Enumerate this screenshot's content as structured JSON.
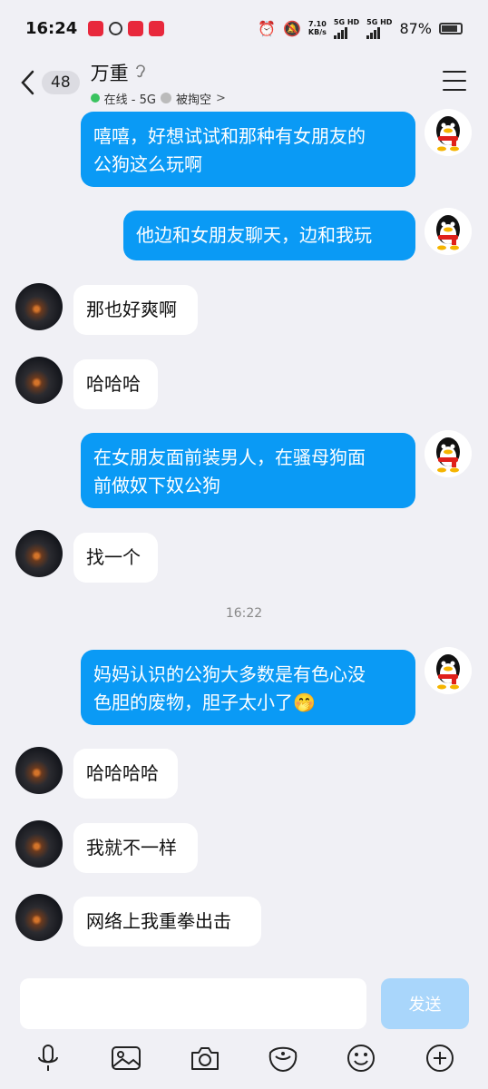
{
  "status_bar": {
    "time": "16:24",
    "net_speed_value": "7.10",
    "net_speed_unit": "KB/s",
    "sim1_label": "5G HD",
    "sim2_label": "5G HD",
    "battery": "87%"
  },
  "header": {
    "unread_count": "48",
    "contact_name": "万重",
    "status_text": "在线 - 5G",
    "poke_text": "被掏空",
    "online_color": "#3ac35f"
  },
  "messages": [
    {
      "side": "out",
      "text_line1": "嘻嘻，好想试试和那种有女朋友的",
      "text_line2": "公狗这么玩啊"
    },
    {
      "side": "out",
      "text_line1": "他边和女朋友聊天，边和我玩"
    },
    {
      "side": "in",
      "text_line1": "那也好爽啊"
    },
    {
      "side": "in",
      "text_line1": "哈哈哈"
    },
    {
      "side": "out",
      "text_line1": "在女朋友面前装男人，在骚母狗面",
      "text_line2": "前做奴下奴公狗"
    },
    {
      "side": "in",
      "text_line1": "找一个"
    },
    {
      "side": "out",
      "text_line1": "妈妈认识的公狗大多数是有色心没",
      "text_line2": "色胆的废物，胆子太小了🤭"
    },
    {
      "side": "in",
      "text_line1": "哈哈哈哈"
    },
    {
      "side": "in",
      "text_line1": "我就不一样"
    },
    {
      "side": "in",
      "text_line1": "网络上我重拳出击"
    }
  ],
  "timestamp": "16:22",
  "input": {
    "value": "",
    "send_label": "发送"
  },
  "colors": {
    "outgoing_bubble": "#0a9af5",
    "incoming_bubble": "#ffffff",
    "background": "#f0f0f5",
    "send_button_disabled": "#a9d6fb"
  },
  "toolbar_icons": [
    "microphone-icon",
    "image-icon",
    "camera-icon",
    "red-packet-icon",
    "emoji-icon",
    "plus-icon"
  ]
}
